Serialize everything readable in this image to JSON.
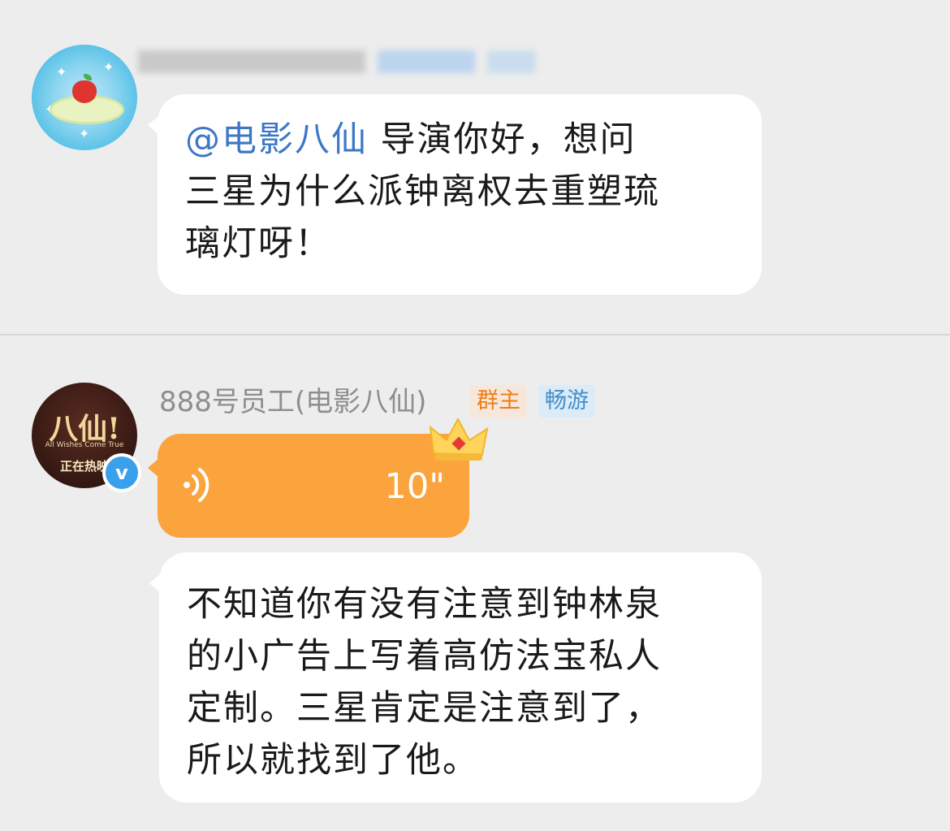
{
  "messages": [
    {
      "sender": "",
      "text_mention": "@电影八仙",
      "text_line1_rest": " 导演你好，想问",
      "text_line2": "三星为什么派钟离权去重塑琉",
      "text_line3": "璃灯呀！"
    },
    {
      "sender": "888号员工(电影八仙)",
      "badge_owner": "群主",
      "badge_tag": "畅游",
      "avatar_title": "八仙!",
      "avatar_subtitle": "All Wishes Come True",
      "avatar_bottom": "正在热映",
      "voice_duration": "10\"",
      "reply_lines": [
        "不知道你有没有注意到钟林泉",
        "的小广告上写着高仿法宝私人",
        "定制。三星肯定是注意到了，",
        "所以就找到了他。"
      ]
    }
  ],
  "icons": {
    "voice": "voice-wave-icon",
    "crown": "crown-icon",
    "verified": "verified-v-icon"
  },
  "colors": {
    "background": "#ededed",
    "mention": "#3d77c6",
    "voice_bubble": "#fba33d",
    "owner_badge_text": "#f07d14",
    "tag_badge_text": "#3f8fd0"
  }
}
